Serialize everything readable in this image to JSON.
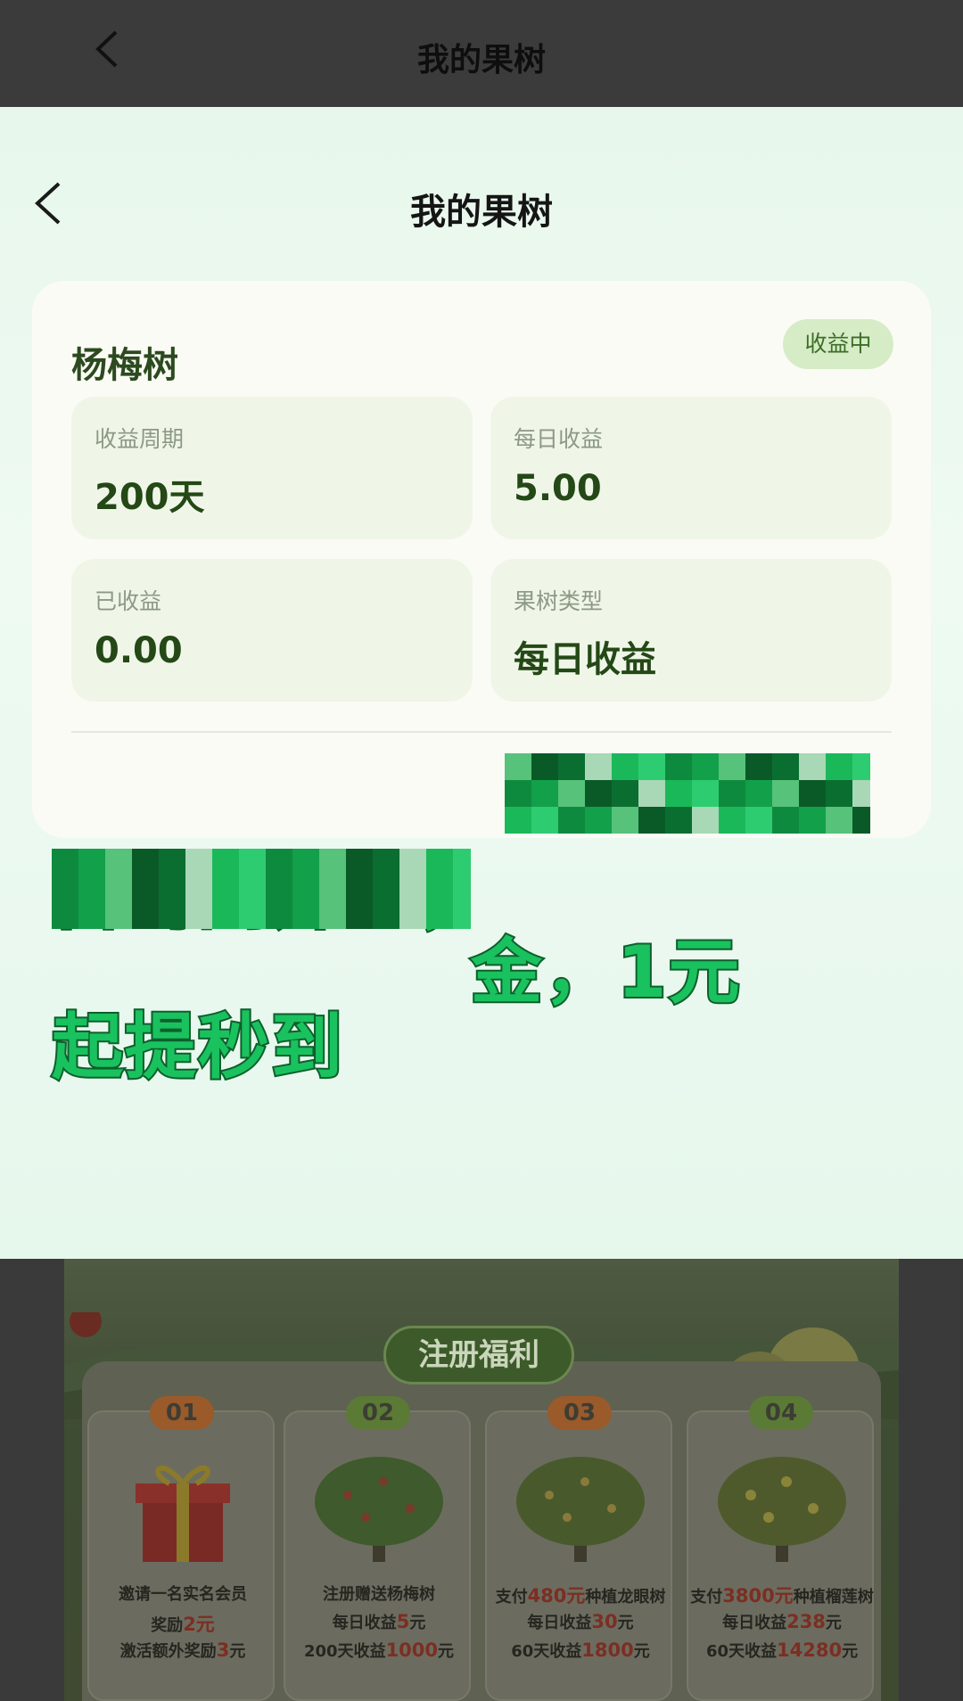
{
  "top_bar": {
    "title": "我的果树",
    "back_icon": "chevron-left-icon"
  },
  "modal": {
    "title": "我的果树",
    "back_icon": "chevron-left-icon",
    "card": {
      "tree_name": "杨梅树",
      "status": "收益中",
      "stats": [
        {
          "label": "收益周期",
          "value": "200天"
        },
        {
          "label": "每日收益",
          "value": "5.00"
        },
        {
          "label": "已收益",
          "value": "0.00"
        },
        {
          "label": "果树类型",
          "value": "每日收益"
        }
      ]
    },
    "caption": {
      "line1": "首码刚开盘，",
      "line2_end": "金，1元",
      "line3": "起提秒到"
    }
  },
  "banner": {
    "heading": "注册福利",
    "perks": [
      {
        "num": "01",
        "num_color": "#9a5a2a",
        "line1": "邀请一名实名会员",
        "line2_pre": "奖励",
        "line2_hl": "2元",
        "line2_post": "",
        "line3_pre": "激活额外奖励",
        "line3_hl": "3",
        "line3_post": "元"
      },
      {
        "num": "02",
        "num_color": "#5b7a35",
        "line1": "注册赠送杨梅树",
        "line2_pre": "每日收益",
        "line2_hl": "5",
        "line2_post": "元",
        "line3_pre": "200天收益",
        "line3_hl": "1000",
        "line3_post": "元"
      },
      {
        "num": "03",
        "num_color": "#9a5a2a",
        "line1_pre": "支付",
        "line1_hl": "480元",
        "line1_post": "种植龙眼树",
        "line2_pre": "每日收益",
        "line2_hl": "30",
        "line2_post": "元",
        "line3_pre": "60天收益",
        "line3_hl": "1800",
        "line3_post": "元"
      },
      {
        "num": "04",
        "num_color": "#5b7a35",
        "line1_pre": "支付",
        "line1_hl": "3800元",
        "line1_post": "种植榴莲树",
        "line2_pre": "每日收益",
        "line2_hl": "238",
        "line2_post": "元",
        "line3_pre": "60天收益",
        "line3_hl": "14280",
        "line3_post": "元"
      }
    ]
  },
  "colors": {
    "accent_green": "#19c25e",
    "caption_outline": "#0d5f2c",
    "status_bg": "#d6ecc7"
  }
}
